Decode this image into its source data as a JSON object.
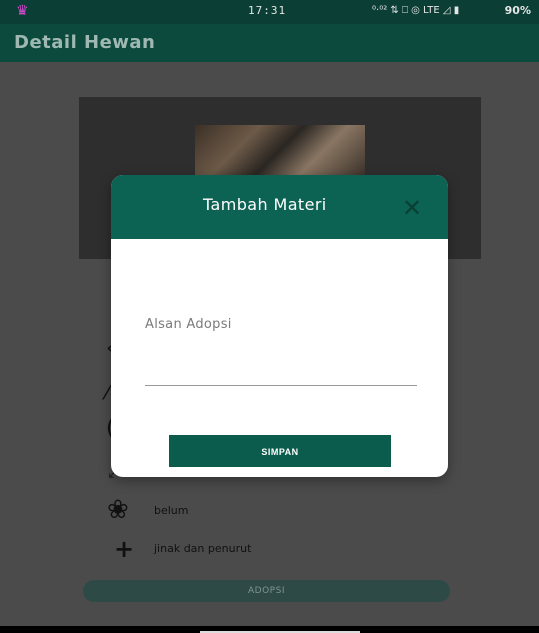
{
  "status_bar": {
    "time": "17:31",
    "icons_text": "⁰·⁰² ⇅ ⎕ ◎ LTE ◿ ▮",
    "battery": "90%"
  },
  "app_bar": {
    "title": "Detail Hewan"
  },
  "detail": {
    "rows": [
      {
        "icon": "toy-icon",
        "text": "belum"
      },
      {
        "icon": "plus-icon",
        "text": "jinak dan penurut"
      }
    ]
  },
  "adopsi_button": {
    "label": "ADOPSI"
  },
  "dialog": {
    "title": "Tambah Materi",
    "close_glyph": "✕",
    "field_label": "Alsan Adopsi",
    "field_value": "",
    "submit_label": "SIMPAN"
  },
  "colors": {
    "primary_dark": "#0c4a3e",
    "dialog_header": "#0c6354",
    "button": "#0c5c4d"
  }
}
